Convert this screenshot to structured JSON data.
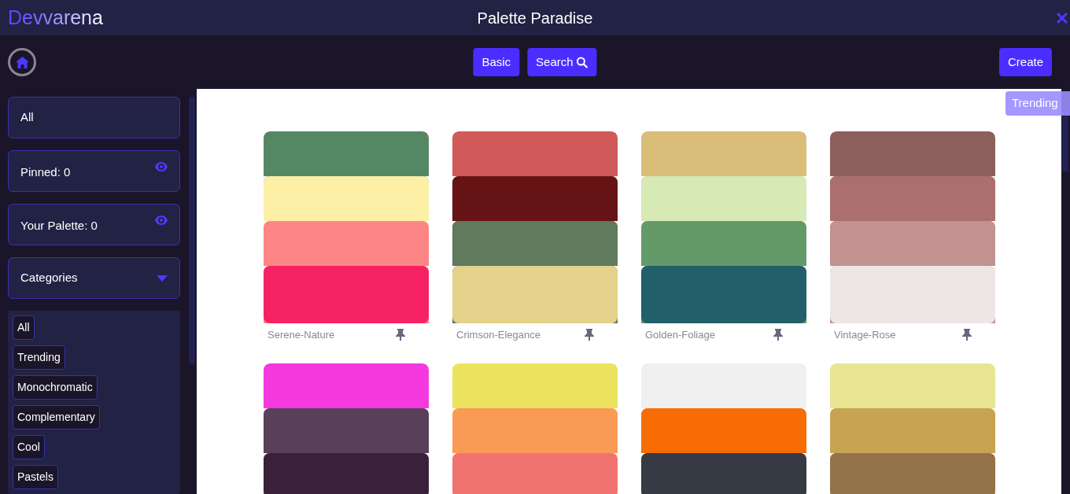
{
  "header": {
    "logo": "Devvarena",
    "title": "Palette Paradise"
  },
  "toolbar": {
    "buttons": [
      "Basic",
      "Search"
    ],
    "create": "Create"
  },
  "sidebar": {
    "items": [
      {
        "label": "All",
        "kind": "plain"
      },
      {
        "label": "Pinned: 0",
        "kind": "eye"
      },
      {
        "label": "Your Palette: 0",
        "kind": "eye"
      },
      {
        "label": "Categories",
        "kind": "dropdown"
      }
    ],
    "categories": [
      "All",
      "Trending",
      "Monochromatic",
      "Complementary",
      "Cool",
      "Pastels"
    ]
  },
  "badge": "Trending",
  "palettes": [
    {
      "name": "Serene-Nature",
      "swatches": [
        {
          "color": "#568764"
        },
        {
          "color": "#fdf0a6"
        },
        {
          "color": "#fe8585"
        },
        {
          "color": "#f52364"
        }
      ]
    },
    {
      "name": "Crimson-Elegance",
      "swatches": [
        {
          "color": "#d05a5a"
        },
        {
          "color": "#661315"
        },
        {
          "color": "#5f7a5c"
        },
        {
          "color": "#e4d18a"
        }
      ]
    },
    {
      "name": "Golden-Foliage",
      "swatches": [
        {
          "color": "#d9bd78"
        },
        {
          "color": "#d7e9b4"
        },
        {
          "color": "#649a68"
        },
        {
          "color": "#215f69"
        }
      ]
    },
    {
      "name": "Vintage-Rose",
      "swatches": [
        {
          "color": "#8c5f5c"
        },
        {
          "color": "#ab706d"
        },
        {
          "color": "#c29290"
        },
        {
          "color": "#ede6e5"
        }
      ]
    },
    {
      "swatches": [
        {
          "color": "#f43ade"
        },
        {
          "color": "#5a3f58"
        },
        {
          "color": "#3a2038"
        }
      ]
    },
    {
      "swatches": [
        {
          "color": "#ebe35e"
        },
        {
          "color": "#f99a55"
        },
        {
          "color": "#f17370"
        }
      ]
    },
    {
      "swatches": [
        {
          "color": "#f0f0f0"
        },
        {
          "color": "#f76c03"
        },
        {
          "color": "#363a44"
        }
      ]
    },
    {
      "swatches": [
        {
          "color": "#e7e592"
        },
        {
          "color": "#c8a352"
        },
        {
          "color": "#94724a"
        }
      ]
    }
  ]
}
